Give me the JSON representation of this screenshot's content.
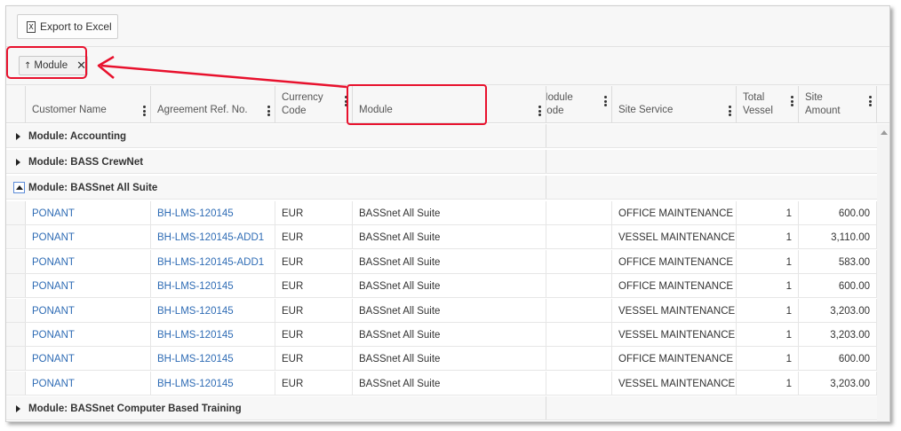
{
  "toolbar": {
    "export_label": "Export to Excel",
    "export_icon": "excel-icon"
  },
  "group_panel": {
    "chip_label": "Module",
    "chip_sort_arrow": "↑",
    "chip_close": "✕"
  },
  "columns": [
    {
      "label": "Customer Name"
    },
    {
      "label": "Agreement Ref. No."
    },
    {
      "label": "Currency Code"
    },
    {
      "label": "Module"
    },
    {
      "label": "Module Code"
    },
    {
      "label": "Site Service"
    },
    {
      "label": "Total Vessel"
    },
    {
      "label": "Site Amount"
    }
  ],
  "groups": [
    {
      "label": "Module: Accounting",
      "expanded": false
    },
    {
      "label": "Module: BASS CrewNet",
      "expanded": false
    },
    {
      "label": "Module: BASSnet All Suite",
      "expanded": true
    },
    {
      "label": "Module: BASSnet Computer Based Training",
      "expanded": false
    }
  ],
  "rows": [
    {
      "customer": "PONANT",
      "ref": "BH-LMS-120145",
      "currency": "EUR",
      "module": "BASSnet All Suite",
      "module_code": "",
      "service": "OFFICE MAINTENANCE",
      "vessels": "1",
      "amount": "600.00"
    },
    {
      "customer": "PONANT",
      "ref": "BH-LMS-120145-ADD1",
      "currency": "EUR",
      "module": "BASSnet All Suite",
      "module_code": "",
      "service": "VESSEL MAINTENANCE",
      "vessels": "1",
      "amount": "3,110.00"
    },
    {
      "customer": "PONANT",
      "ref": "BH-LMS-120145-ADD1",
      "currency": "EUR",
      "module": "BASSnet All Suite",
      "module_code": "",
      "service": "OFFICE MAINTENANCE",
      "vessels": "1",
      "amount": "583.00"
    },
    {
      "customer": "PONANT",
      "ref": "BH-LMS-120145",
      "currency": "EUR",
      "module": "BASSnet All Suite",
      "module_code": "",
      "service": "OFFICE MAINTENANCE",
      "vessels": "1",
      "amount": "600.00"
    },
    {
      "customer": "PONANT",
      "ref": "BH-LMS-120145",
      "currency": "EUR",
      "module": "BASSnet All Suite",
      "module_code": "",
      "service": "VESSEL MAINTENANCE",
      "vessels": "1",
      "amount": "3,203.00"
    },
    {
      "customer": "PONANT",
      "ref": "BH-LMS-120145",
      "currency": "EUR",
      "module": "BASSnet All Suite",
      "module_code": "",
      "service": "VESSEL MAINTENANCE",
      "vessels": "1",
      "amount": "3,203.00"
    },
    {
      "customer": "PONANT",
      "ref": "BH-LMS-120145",
      "currency": "EUR",
      "module": "BASSnet All Suite",
      "module_code": "",
      "service": "OFFICE MAINTENANCE",
      "vessels": "1",
      "amount": "600.00"
    },
    {
      "customer": "PONANT",
      "ref": "BH-LMS-120145",
      "currency": "EUR",
      "module": "BASSnet All Suite",
      "module_code": "",
      "service": "VESSEL MAINTENANCE",
      "vessels": "1",
      "amount": "3,203.00"
    }
  ],
  "annotation": {
    "highlight_color": "#e8112d"
  },
  "colors": {
    "link": "#2f6cb5",
    "header_bg": "#f7f7f7"
  }
}
